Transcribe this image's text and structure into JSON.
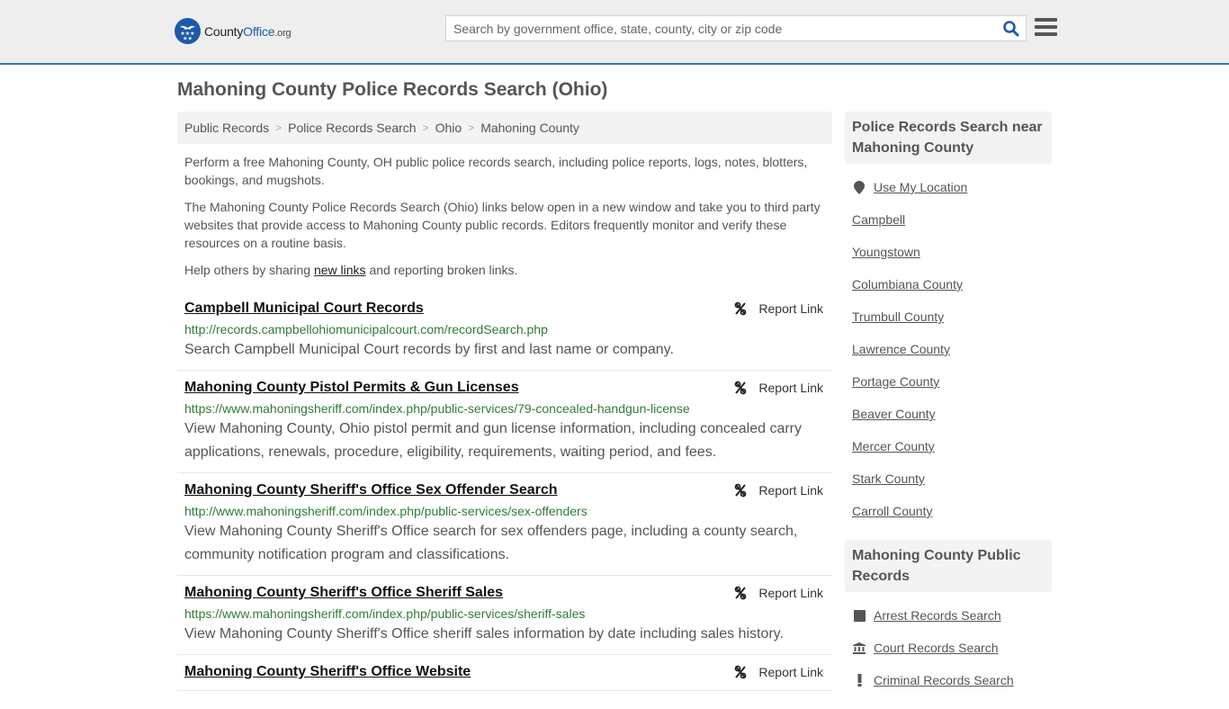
{
  "header": {
    "logo": {
      "name_part1": "County",
      "name_part2": "Office",
      "tld": ".org"
    },
    "search": {
      "placeholder": "Search by government office, state, county, city or zip code",
      "value": ""
    },
    "colors": {
      "brand_blue": "#1d5aa6",
      "accent_border": "#337ab7"
    }
  },
  "page": {
    "title": "Mahoning County Police Records Search (Ohio)"
  },
  "breadcrumb": [
    {
      "label": "Public Records"
    },
    {
      "label": "Police Records Search"
    },
    {
      "label": "Ohio"
    },
    {
      "label": "Mahoning County"
    }
  ],
  "intro": {
    "p1": "Perform a free Mahoning County, OH public police records search, including police reports, logs, notes, blotters, bookings, and mugshots.",
    "p2": "The Mahoning County Police Records Search (Ohio) links below open in a new window and take you to third party websites that provide access to Mahoning County public records. Editors frequently monitor and verify these resources on a routine basis.",
    "p3_before": "Help others by sharing ",
    "p3_link": "new links",
    "p3_after": " and reporting broken links."
  },
  "results": [
    {
      "title": "Campbell Municipal Court Records",
      "url": "http://records.campbellohiomunicipalcourt.com/recordSearch.php",
      "description": "Search Campbell Municipal Court records by first and last name or company.",
      "report_label": "Report Link"
    },
    {
      "title": "Mahoning County Pistol Permits & Gun Licenses",
      "url": "https://www.mahoningsheriff.com/index.php/public-services/79-concealed-handgun-license",
      "description": "View Mahoning County, Ohio pistol permit and gun license information, including concealed carry applications, renewals, procedure, eligibility, requirements, waiting period, and fees.",
      "report_label": "Report Link"
    },
    {
      "title": "Mahoning County Sheriff's Office Sex Offender Search",
      "url": "http://www.mahoningsheriff.com/index.php/public-services/sex-offenders",
      "description": "View Mahoning County Sheriff's Office search for sex offenders page, including a county search, community notification program and classifications.",
      "report_label": "Report Link"
    },
    {
      "title": "Mahoning County Sheriff's Office Sheriff Sales",
      "url": "https://www.mahoningsheriff.com/index.php/public-services/sheriff-sales",
      "description": "View Mahoning County Sheriff's Office sheriff sales information by date including sales history.",
      "report_label": "Report Link"
    },
    {
      "title": "Mahoning County Sheriff's Office Website",
      "url": "",
      "description": "",
      "report_label": "Report Link"
    }
  ],
  "sidebar": {
    "nearby": {
      "heading": "Police Records Search near Mahoning County",
      "use_location": {
        "label": "Use My Location",
        "icon": "map-marker-icon"
      },
      "items": [
        "Campbell",
        "Youngstown",
        "Columbiana County",
        "Trumbull County",
        "Lawrence County",
        "Portage County",
        "Beaver County",
        "Mercer County",
        "Stark County",
        "Carroll County"
      ]
    },
    "public_records": {
      "heading": "Mahoning County Public Records",
      "items": [
        {
          "label": "Arrest Records Search",
          "icon": "square-icon"
        },
        {
          "label": "Court Records Search",
          "icon": "courthouse-icon"
        },
        {
          "label": "Criminal Records Search",
          "icon": "exclamation-icon"
        }
      ]
    }
  }
}
